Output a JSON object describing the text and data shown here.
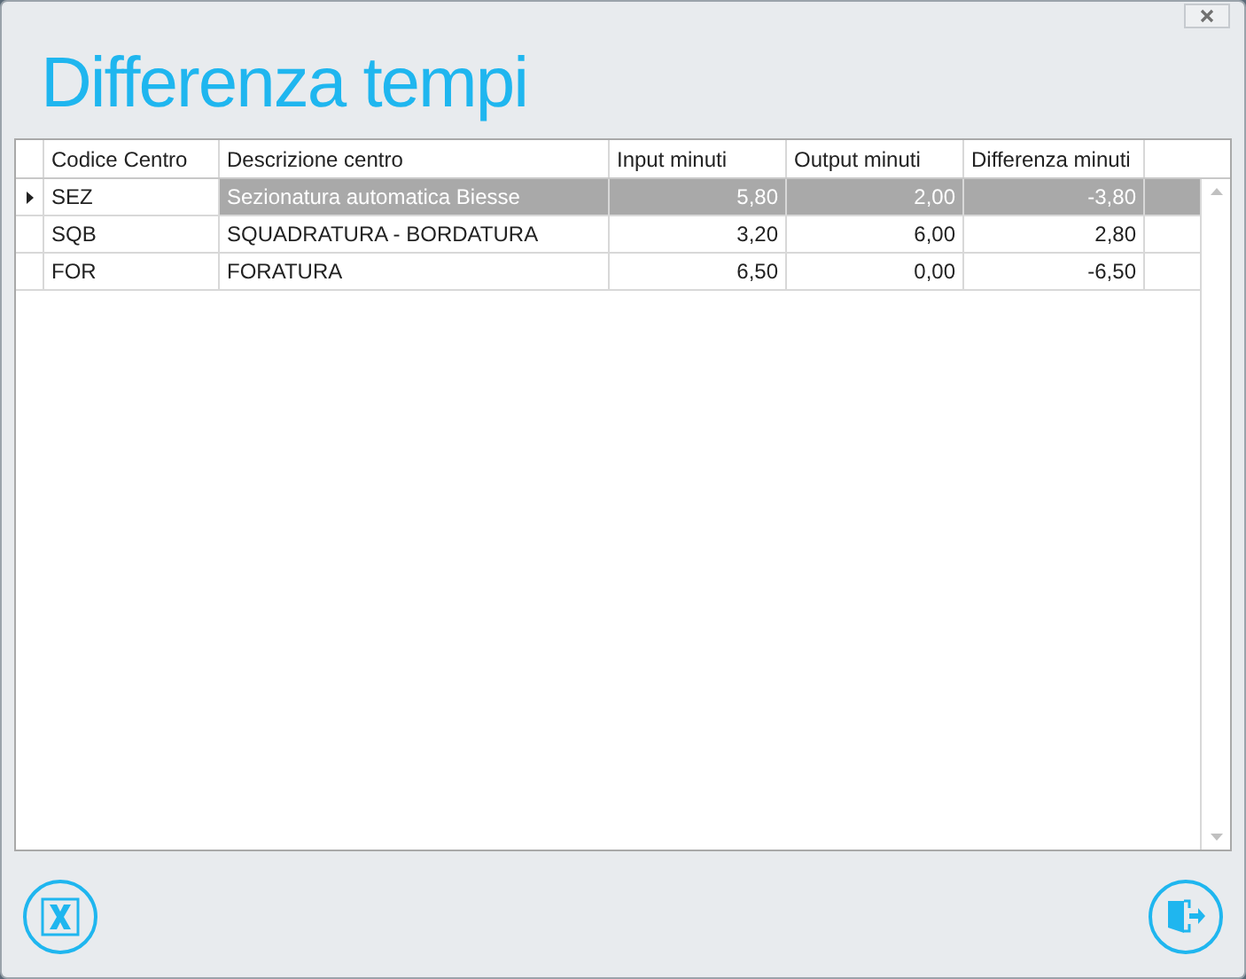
{
  "window": {
    "title": "Differenza tempi"
  },
  "table": {
    "columns": [
      "Codice Centro",
      "Descrizione centro",
      "Input minuti",
      "Output minuti",
      "Differenza minuti"
    ],
    "rows": [
      {
        "selected": true,
        "cells": [
          "SEZ",
          "Sezionatura automatica Biesse",
          "5,80",
          "2,00",
          "-3,80"
        ]
      },
      {
        "selected": false,
        "cells": [
          "SQB",
          "SQUADRATURA - BORDATURA",
          "3,20",
          "6,00",
          "2,80"
        ]
      },
      {
        "selected": false,
        "cells": [
          "FOR",
          "FORATURA",
          "6,50",
          "0,00",
          "-6,50"
        ]
      }
    ]
  }
}
